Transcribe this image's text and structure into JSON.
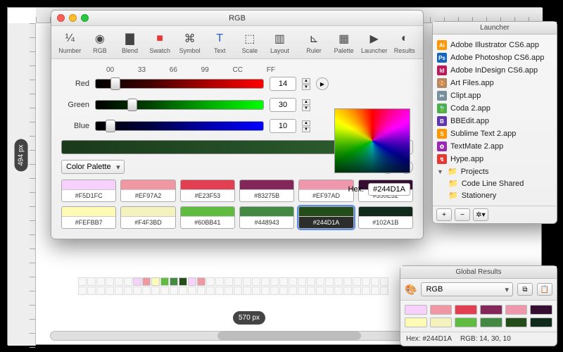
{
  "canvas": {
    "width_label": "570 px",
    "height_label": "494 px"
  },
  "rgb_window": {
    "title": "RGB",
    "toolbar": [
      {
        "id": "number",
        "label": "Number",
        "glyph": "¼"
      },
      {
        "id": "rgb",
        "label": "RGB",
        "glyph": "◉"
      },
      {
        "id": "blend",
        "label": "Blend",
        "glyph": "▇"
      },
      {
        "id": "swatch",
        "label": "Swatch",
        "glyph": "■",
        "color": "#e53935"
      },
      {
        "id": "symbol",
        "label": "Symbol",
        "glyph": "⌘"
      },
      {
        "id": "text",
        "label": "Text",
        "glyph": "T",
        "color": "#2a5fd0"
      },
      {
        "id": "scale",
        "label": "Scale",
        "glyph": "⬚"
      },
      {
        "id": "layout",
        "label": "Layout",
        "glyph": "▥"
      },
      {
        "id": "ruler",
        "label": "Ruler",
        "glyph": "⊾"
      },
      {
        "id": "palette",
        "label": "Palette",
        "glyph": "▦"
      },
      {
        "id": "launcher",
        "label": "Launcher",
        "glyph": "▶"
      },
      {
        "id": "results",
        "label": "Results",
        "glyph": "◐"
      }
    ],
    "hex_marks": [
      "00",
      "33",
      "66",
      "99",
      "CC",
      "FF"
    ],
    "channels": {
      "red": {
        "label": "Red",
        "value": "14",
        "pos_pct": 9
      },
      "green": {
        "label": "Green",
        "value": "30",
        "pos_pct": 19
      },
      "blue": {
        "label": "Blue",
        "value": "10",
        "pos_pct": 6
      }
    },
    "hex_label": "Hex:",
    "hex_value": "#244D1A",
    "palette_dropdown": "Color Palette",
    "swatches": [
      {
        "hex": "#F5D1FC"
      },
      {
        "hex": "#EF97A2"
      },
      {
        "hex": "#E23F53"
      },
      {
        "hex": "#83275B"
      },
      {
        "hex": "#EF97AD"
      },
      {
        "hex": "#350E32"
      },
      {
        "hex": "#FEFBB7"
      },
      {
        "hex": "#F4F3BD"
      },
      {
        "hex": "#60BB41"
      },
      {
        "hex": "#448943"
      },
      {
        "hex": "#244D1A",
        "active": true
      },
      {
        "hex": "#102A1B"
      }
    ]
  },
  "launcher": {
    "title": "Launcher",
    "items": [
      {
        "label": "Adobe Illustrator CS6.app",
        "icon_bg": "#ff9800",
        "icon_txt": "Ai"
      },
      {
        "label": "Adobe Photoshop CS6.app",
        "icon_bg": "#1565c0",
        "icon_txt": "Ps"
      },
      {
        "label": "Adobe InDesign CS6.app",
        "icon_bg": "#c2185b",
        "icon_txt": "Id"
      },
      {
        "label": "Art Files.app",
        "icon_bg": "#b58863",
        "icon_txt": "🎨"
      },
      {
        "label": "Clipt.app",
        "icon_bg": "#78909c",
        "icon_txt": "✂"
      },
      {
        "label": "Coda 2.app",
        "icon_bg": "#4caf50",
        "icon_txt": "🍃"
      },
      {
        "label": "BBEdit.app",
        "icon_bg": "#5e35b1",
        "icon_txt": "B"
      },
      {
        "label": "Sublime Text 2.app",
        "icon_bg": "#ff9800",
        "icon_txt": "S"
      },
      {
        "label": "TextMate 2.app",
        "icon_bg": "#9c27b0",
        "icon_txt": "✿"
      },
      {
        "label": "Hype.app",
        "icon_bg": "#e53935",
        "icon_txt": "↯"
      }
    ],
    "projects_label": "Projects",
    "projects": [
      {
        "label": "Code Line Shared"
      },
      {
        "label": "Stationery"
      }
    ]
  },
  "results": {
    "title": "Global Results",
    "mode": "RGB",
    "swatches": [
      "#F5D1FC",
      "#EF97A2",
      "#E23F53",
      "#83275B",
      "#EF97AD",
      "#350E32",
      "#FEFBB7",
      "#F4F3BD",
      "#60BB41",
      "#448943",
      "#244D1A",
      "#102A1B"
    ],
    "hex_label": "Hex:",
    "hex_value": "#244D1A",
    "rgb_label": "RGB:",
    "rgb_value": "14, 30, 10"
  }
}
